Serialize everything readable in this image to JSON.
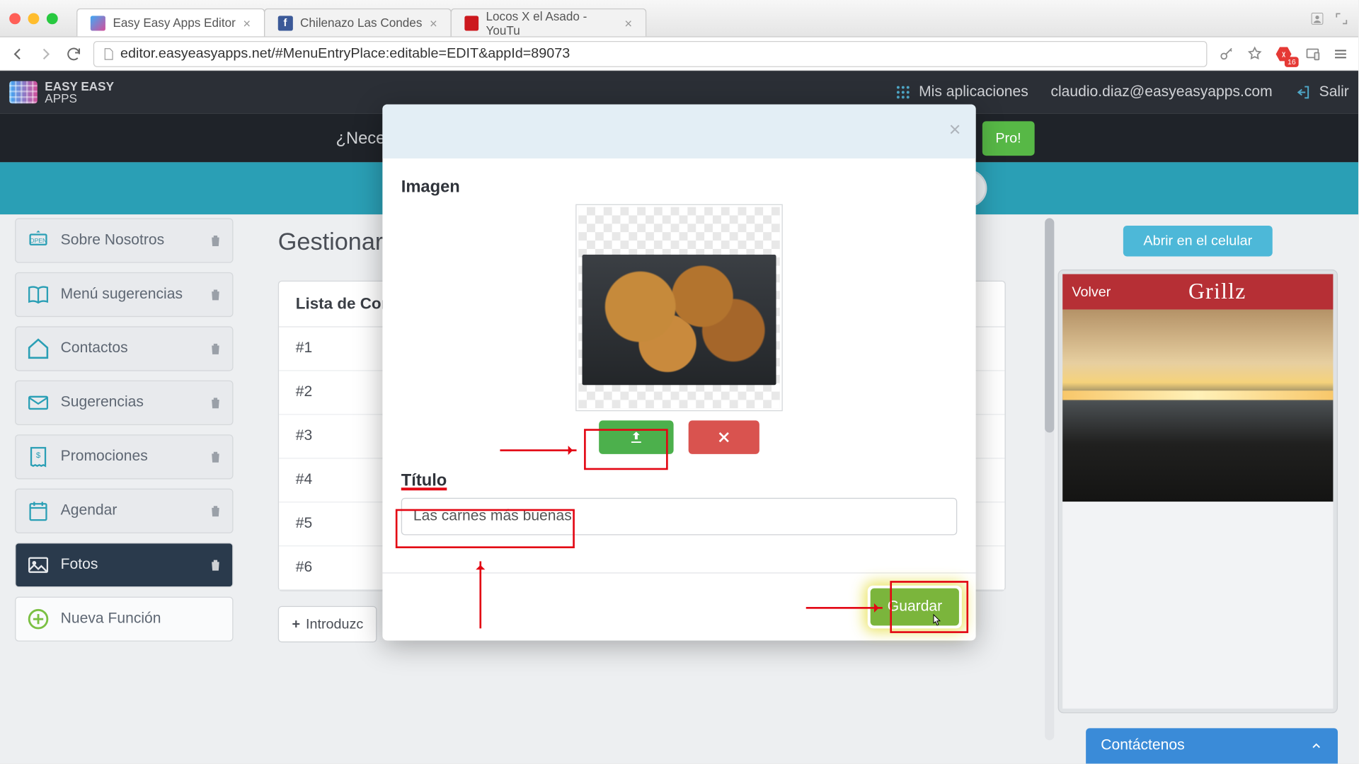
{
  "browser": {
    "tabs": [
      {
        "title": "Easy Easy Apps Editor"
      },
      {
        "title": "Chilenazo Las Condes"
      },
      {
        "title": "Locos X el Asado - YouTu"
      }
    ],
    "url": "editor.easyeasyapps.net/#MenuEntryPlace:editable=EDIT&appId=89073"
  },
  "app": {
    "logo_line1": "EASY EASY",
    "logo_line2": "APPS",
    "header_links": {
      "my_apps": "Mis aplicaciones",
      "user": "claudio.diaz@easyeasyapps.com",
      "logout": "Salir"
    },
    "subheader_text": "¿Nece",
    "pro_text": "Pro!"
  },
  "sidebar": [
    {
      "label": "Sobre Nosotros",
      "icon": "open"
    },
    {
      "label": "Menú sugerencias",
      "icon": "book"
    },
    {
      "label": "Contactos",
      "icon": "home"
    },
    {
      "label": "Sugerencias",
      "icon": "mail"
    },
    {
      "label": "Promociones",
      "icon": "receipt"
    },
    {
      "label": "Agendar",
      "icon": "calendar"
    },
    {
      "label": "Fotos",
      "icon": "photo",
      "active": true
    }
  ],
  "sidebar_new": "Nueva Función",
  "main": {
    "heading": "Gestionar e",
    "list_header": "Lista de Con",
    "rows": [
      "#1",
      "#2",
      "#3",
      "#4",
      "#5",
      "#6"
    ],
    "add_label": "Introduzc"
  },
  "preview": {
    "open_btn": "Abrir en el celular",
    "back": "Volver",
    "brand": "Grillz"
  },
  "contact_bar": "Contáctenos",
  "modal": {
    "image_label": "Imagen",
    "title_label": "Título",
    "title_value": "Las carnes más buenas!",
    "save": "Guardar"
  }
}
